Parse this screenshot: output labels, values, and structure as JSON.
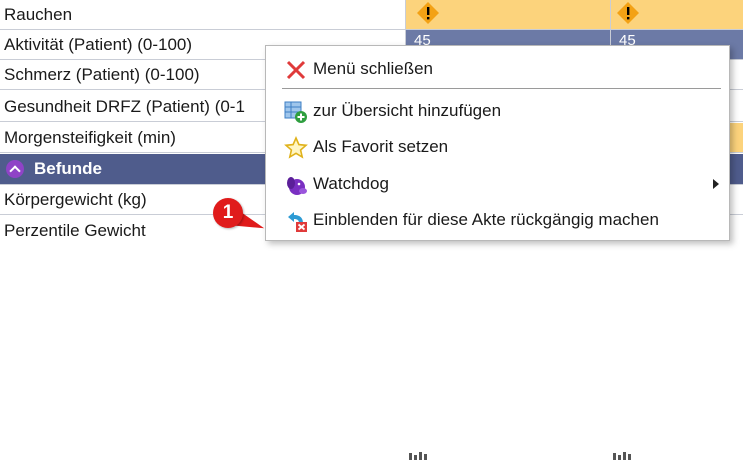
{
  "rows": [
    {
      "label": "Rauchen",
      "warning": true
    },
    {
      "label": "Aktivität (Patient) (0-100)",
      "value_a": "45",
      "value_b": "45"
    },
    {
      "label": "Schmerz (Patient) (0-100)"
    },
    {
      "label": "Gesundheit DRFZ (Patient) (0-1"
    },
    {
      "label": "Morgensteifigkeit (min)"
    },
    {
      "label": "Befunde",
      "section": true
    },
    {
      "label": "Körpergewicht (kg)"
    },
    {
      "label": "Perzentile Gewicht"
    }
  ],
  "context_menu": {
    "items": [
      {
        "label": "Menü schließen",
        "icon": "close-icon"
      },
      {
        "label": "zur Übersicht hinzufügen",
        "icon": "add-to-overview-icon"
      },
      {
        "label": "Als Favorit setzen",
        "icon": "star-icon"
      },
      {
        "label": "Watchdog",
        "icon": "watchdog-icon",
        "has_submenu": true
      },
      {
        "label": "Einblenden für diese Akte rückgängig machen",
        "icon": "undo-show-icon"
      }
    ]
  },
  "annotation": {
    "number": "1"
  },
  "colors": {
    "warning": "#fcd37c",
    "section": "#4f5c8c",
    "value_cell": "#6c7aa6",
    "badge": "#e01b1b"
  }
}
